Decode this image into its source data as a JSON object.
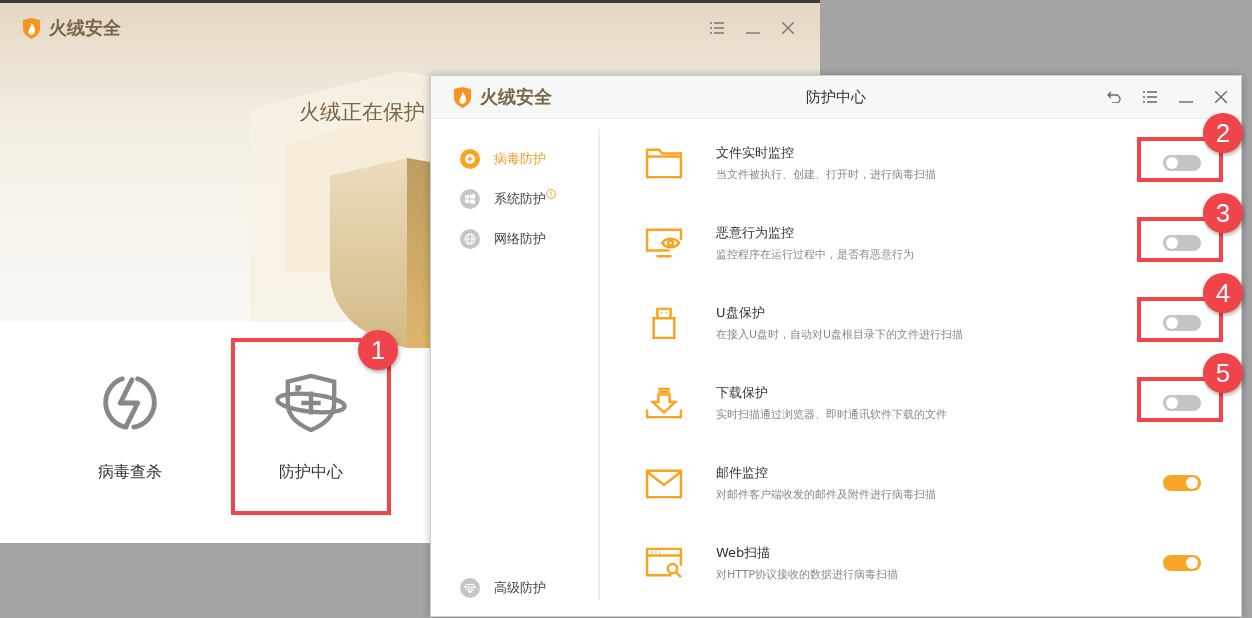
{
  "main_window": {
    "app_name": "火绒安全",
    "headline": "火绒正在保护",
    "tools": [
      {
        "label": "病毒查杀"
      },
      {
        "label": "防护中心",
        "callout": "1"
      }
    ]
  },
  "protection_dialog": {
    "app_name": "火绒安全",
    "title": "防护中心",
    "sidebar": {
      "items": [
        {
          "label": "病毒防护",
          "selected": true,
          "alert": false
        },
        {
          "label": "系统防护",
          "selected": false,
          "alert": true
        },
        {
          "label": "网络防护",
          "selected": false,
          "alert": false
        }
      ],
      "footer_item": {
        "label": "高级防护",
        "selected": false
      }
    },
    "items": [
      {
        "title": "文件实时监控",
        "description": "当文件被执行、创建、打开时，进行病毒扫描",
        "on": false,
        "callout": "2"
      },
      {
        "title": "恶意行为监控",
        "description": "监控程序在运行过程中，是否有恶意行为",
        "on": false,
        "callout": "3"
      },
      {
        "title": "U盘保护",
        "description": "在接入U盘时，自动对U盘根目录下的文件进行扫描",
        "on": false,
        "callout": "4"
      },
      {
        "title": "下载保护",
        "description": "实时扫描通过浏览器、即时通讯软件下载的文件",
        "on": false,
        "callout": "5"
      },
      {
        "title": "邮件监控",
        "description": "对邮件客户端收发的邮件及附件进行病毒扫描",
        "on": true
      },
      {
        "title": "Web扫描",
        "description": "对HTTP协议接收的数据进行病毒扫描",
        "on": true
      }
    ]
  }
}
